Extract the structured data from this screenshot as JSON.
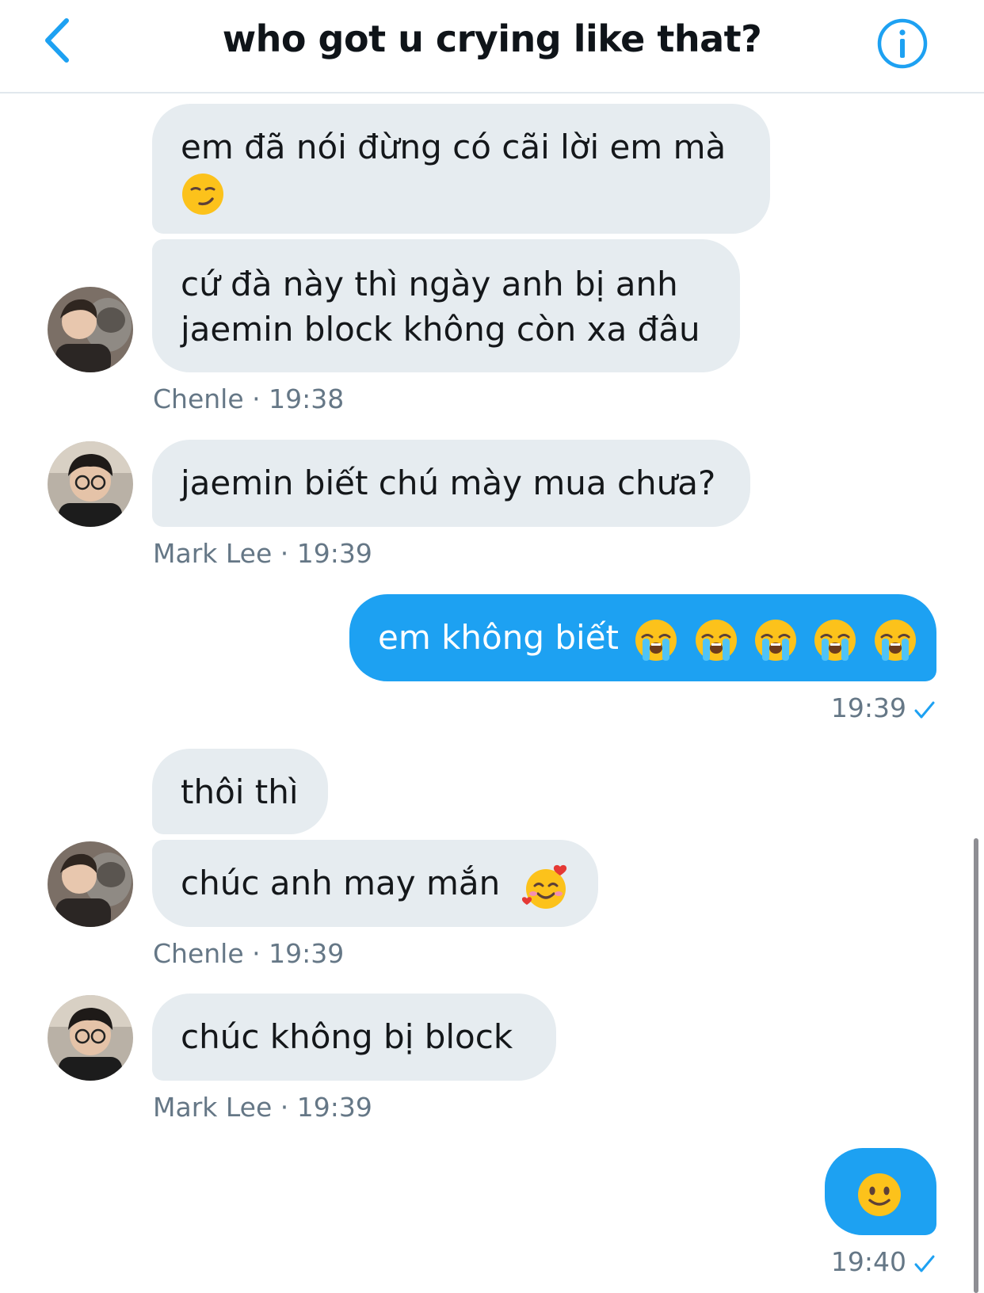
{
  "header": {
    "title": "who got u crying like that?",
    "back_icon": "chevron-left-icon",
    "info_icon": "info-icon"
  },
  "colors": {
    "accent": "#1da1f2",
    "incoming_bubble": "#e6ecf0",
    "meta_text": "#657786"
  },
  "messages": [
    {
      "sender": "Chenle",
      "text": "em đã nói đừng có cãi lời em mà",
      "emoji": "smirking-face-emoji"
    },
    {
      "sender": "Chenle",
      "text_line1": "cứ đà này thì ngày anh bị anh",
      "text_line2": "jaemin block không còn xa đâu"
    },
    {
      "meta": "Chenle · 19:38"
    },
    {
      "sender": "Mark Lee",
      "text": "jaemin biết chú mày mua chưa?"
    },
    {
      "meta": "Mark Lee · 19:39"
    },
    {
      "sender": "me",
      "text": "em không biết",
      "emoji": "loudly-crying-face-emoji x5"
    },
    {
      "meta": "19:39"
    },
    {
      "sender": "Chenle",
      "text": "thôi thì"
    },
    {
      "sender": "Chenle",
      "text": "chúc anh may mắn",
      "emoji": "smiling-face-with-hearts-emoji"
    },
    {
      "meta": "Chenle · 19:39"
    },
    {
      "sender": "Mark Lee",
      "text": "chúc không bị block"
    },
    {
      "meta": "Mark Lee · 19:39"
    },
    {
      "sender": "me",
      "emoji": "slightly-smiling-face-emoji"
    },
    {
      "meta": "19:40"
    }
  ]
}
